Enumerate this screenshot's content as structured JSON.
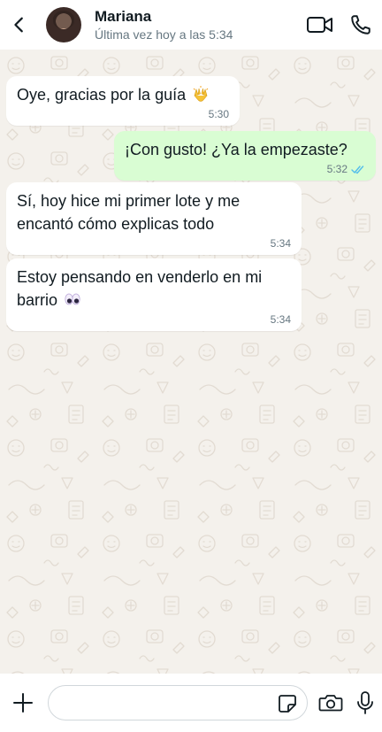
{
  "header": {
    "contact_name": "Mariana",
    "contact_status": "Última vez hoy a las 5:34",
    "icons": {
      "back": "chevron-left-icon",
      "video": "video-camera-icon",
      "call": "phone-icon"
    }
  },
  "messages": [
    {
      "direction": "in",
      "text": "Oye, gracias por la guía",
      "emoji": "raised-hands-emoji",
      "time": "5:30"
    },
    {
      "direction": "out",
      "text": "¡Con gusto! ¿Ya la empezaste?",
      "time": "5:32",
      "status": "read"
    },
    {
      "direction": "in",
      "text": "Sí, hoy hice mi primer lote y me encantó cómo explicas todo",
      "time": "5:34"
    },
    {
      "direction": "in",
      "text": "Estoy pensando en venderlo en mi barrio",
      "emoji": "eyes-emoji",
      "time": "5:34"
    }
  ],
  "composer": {
    "placeholder": "",
    "icons": {
      "attach": "plus-icon",
      "sticker": "sticker-icon",
      "camera": "camera-icon",
      "mic": "microphone-icon"
    }
  },
  "colors": {
    "incoming_bubble": "#ffffff",
    "outgoing_bubble": "#d9fdd3",
    "chat_background": "#f4f1ec",
    "read_ticks": "#53bdeb"
  }
}
